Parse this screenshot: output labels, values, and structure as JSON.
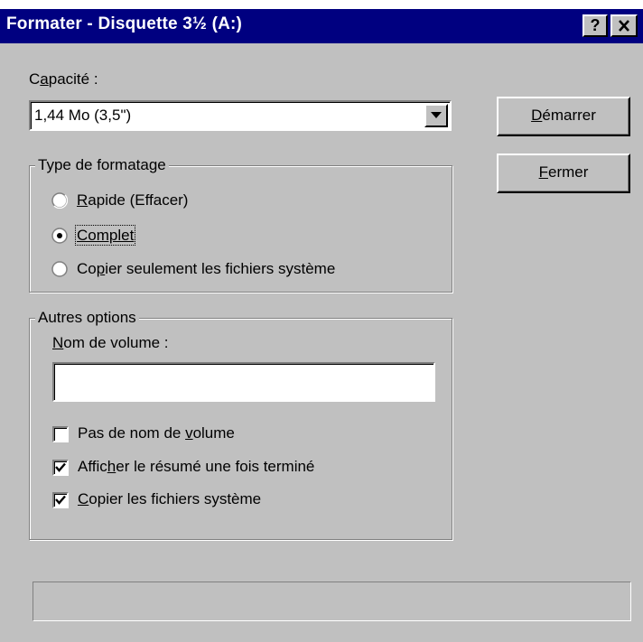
{
  "window": {
    "title": "Formater - Disquette 3½ (A:)",
    "help_button": "?",
    "close_button": "✕"
  },
  "capacity": {
    "label_pre": "C",
    "label_ul": "a",
    "label_post": "pacité :",
    "value": "1,44 Mo (3,5\")"
  },
  "buttons": {
    "start": {
      "ul": "D",
      "rest": "émarrer"
    },
    "close": {
      "ul": "F",
      "rest": "ermer"
    }
  },
  "format_type": {
    "legend": "Type de formatage",
    "options": [
      {
        "pre": "",
        "ul": "R",
        "post": "apide (Effacer)",
        "selected": false
      },
      {
        "pre": "",
        "ul": "",
        "post": "Complet",
        "selected": true
      },
      {
        "pre": "Co",
        "ul": "p",
        "post": "ier seulement les fichiers système",
        "selected": false
      }
    ]
  },
  "other_options": {
    "legend": "Autres options",
    "volume_label": {
      "ul": "N",
      "rest": "om de volume :"
    },
    "volume_value": "",
    "checkboxes": [
      {
        "pre": "Pas de nom de ",
        "ul": "v",
        "post": "olume",
        "checked": false
      },
      {
        "pre": "Affic",
        "ul": "h",
        "post": "er le résumé une fois terminé",
        "checked": true
      },
      {
        "pre": "",
        "ul": "C",
        "post": "opier les fichiers système",
        "checked": true
      }
    ]
  },
  "progress": {
    "value": 0
  },
  "colors": {
    "titlebar": "#000080",
    "face": "#c0c0c0"
  }
}
